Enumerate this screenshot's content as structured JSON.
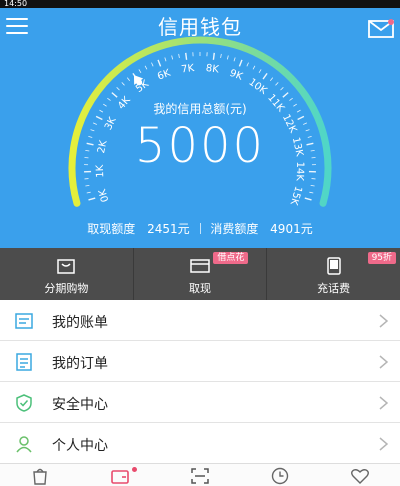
{
  "status_bar": {
    "text": "14:50"
  },
  "header": {
    "title": "信用钱包"
  },
  "gauge": {
    "caption": "我的信用总额(元)",
    "value": "5000",
    "ticks": [
      "0K",
      "1K",
      "2K",
      "3K",
      "4K",
      "5K",
      "6K",
      "7K",
      "8K",
      "9K",
      "10K",
      "11K",
      "12K",
      "13K",
      "14K",
      "15K"
    ],
    "fill_fraction": 0.333,
    "colors": {
      "start": "#e6ef3a",
      "end": "#4fd6c8",
      "track": "#8ac4f0"
    }
  },
  "limits": {
    "cash_label": "取现额度",
    "cash_value": "2451元",
    "spend_label": "消费额度",
    "spend_value": "4901元"
  },
  "quick_actions": [
    {
      "label": "分期购物",
      "icon": "shopping-bag-icon",
      "badge": ""
    },
    {
      "label": "取现",
      "icon": "card-icon",
      "badge": "借点花"
    },
    {
      "label": "充话费",
      "icon": "phone-icon",
      "badge": "95折"
    }
  ],
  "menu": [
    {
      "label": "我的账单",
      "icon": "bill-icon"
    },
    {
      "label": "我的订单",
      "icon": "order-icon"
    },
    {
      "label": "安全中心",
      "icon": "shield-icon"
    },
    {
      "label": "个人中心",
      "icon": "user-icon"
    }
  ],
  "tabbar": [
    "bag-icon",
    "wallet-icon",
    "scan-icon",
    "clock-icon",
    "heart-icon"
  ],
  "colors": {
    "header_bg": "#3aa0ec",
    "quickbar_bg": "#4c4c4c",
    "badge": "#ef6a8a",
    "menu_icon": "#3aa8e0",
    "shield_icon": "#4cc07a",
    "user_icon": "#6ac06a"
  }
}
